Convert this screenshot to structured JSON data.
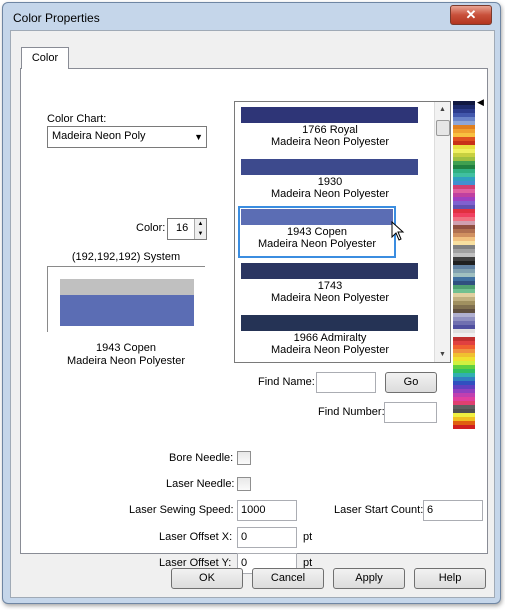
{
  "window": {
    "title": "Color Properties",
    "close_label": "✕"
  },
  "tabs": [
    {
      "label": "Color"
    }
  ],
  "color_chart": {
    "label": "Color Chart:",
    "selected": "Madeira Neon Poly"
  },
  "color_number": {
    "label": "Color:",
    "value": "16"
  },
  "system_color": {
    "label": "(192,192,192) System",
    "top_color": "#c0c0c0",
    "bottom_color": "#5b6db4"
  },
  "current_color": {
    "name": "1943 Copen",
    "chart": "Madeira Neon Polyester"
  },
  "color_list": [
    {
      "name": "1766 Royal",
      "chart": "Madeira Neon Polyester",
      "color": "#2e3577",
      "selected": false
    },
    {
      "name": "1930",
      "chart": "Madeira Neon Polyester",
      "color": "#3d4a8d",
      "selected": false
    },
    {
      "name": "1943 Copen",
      "chart": "Madeira Neon Polyester",
      "color": "#5b6db4",
      "selected": true
    },
    {
      "name": "1743",
      "chart": "Madeira Neon Polyester",
      "color": "#2a3561",
      "selected": false
    },
    {
      "name": "1966 Admiralty",
      "chart": "Madeira Neon Polyester",
      "color": "#253355",
      "selected": false
    }
  ],
  "find_name": {
    "label": "Find Name:",
    "value": "",
    "go_label": "Go"
  },
  "find_number": {
    "label": "Find Number:",
    "value": ""
  },
  "options": {
    "bore_needle_label": "Bore Needle:",
    "laser_needle_label": "Laser Needle:",
    "laser_sewing_speed_label": "Laser Sewing Speed:",
    "laser_sewing_speed": "1000",
    "laser_start_count_label": "Laser Start Count:",
    "laser_start_count": "6",
    "laser_offset_x_label": "Laser Offset X:",
    "laser_offset_x": "0",
    "laser_offset_y_label": "Laser Offset Y:",
    "laser_offset_y": "0",
    "unit_x": "pt",
    "unit_y": "pt"
  },
  "buttons": {
    "ok": "OK",
    "cancel": "Cancel",
    "apply": "Apply",
    "help": "Help"
  },
  "palette_colors": [
    "#101840",
    "#1c2a6a",
    "#2c3c8c",
    "#4258ac",
    "#6a84c8",
    "#8ea6d8",
    "#e08020",
    "#f0a030",
    "#f8c040",
    "#e05020",
    "#c83018",
    "#e8e040",
    "#f0f060",
    "#c8d040",
    "#a0c040",
    "#40a050",
    "#208040",
    "#30b080",
    "#40c0a0",
    "#30a0c0",
    "#4090d0",
    "#d04070",
    "#e060a0",
    "#c040a0",
    "#a040c0",
    "#8060d0",
    "#6050b0",
    "#e03040",
    "#f04060",
    "#f07080",
    "#d0a0b0",
    "#905040",
    "#b07050",
    "#d09060",
    "#f0c080",
    "#f8e0a0",
    "#808080",
    "#a0a0a0",
    "#c0c0c0",
    "#404040",
    "#202020",
    "#6080a0",
    "#80a0b0",
    "#a0c0c0",
    "#4070a0",
    "#305080",
    "#50a070",
    "#70c090",
    "#e0d0a0",
    "#c0b080",
    "#a09060",
    "#807050",
    "#605040",
    "#b0b0d0",
    "#9090c0",
    "#7070b0",
    "#5050a0",
    "#e0e0e0",
    "#f0f0f0",
    "#c03030",
    "#e04040",
    "#f06030",
    "#f09040",
    "#f0c030",
    "#f0e030",
    "#d0f040",
    "#60d040",
    "#30c060",
    "#30b0b0",
    "#3080c0",
    "#3050c0",
    "#6040c0",
    "#9040c0",
    "#c040b0",
    "#e040a0",
    "#e04070",
    "#606060",
    "#505050",
    "#f0f040",
    "#f0c020",
    "#e06010",
    "#d02020"
  ]
}
